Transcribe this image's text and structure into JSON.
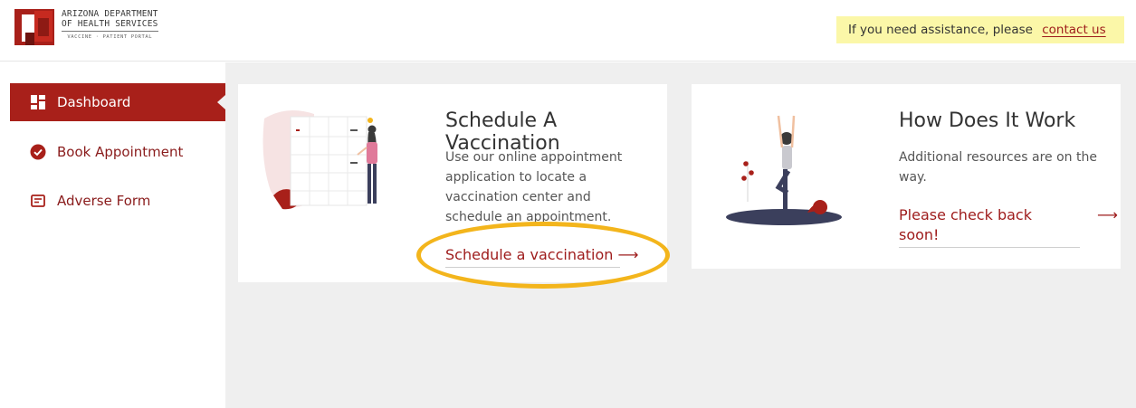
{
  "header": {
    "logo": {
      "line1": "ARIZONA DEPARTMENT",
      "line2": "OF HEALTH SERVICES",
      "subtitle": "VACCINE · PATIENT PORTAL"
    },
    "assistance": {
      "text": "If you need assistance, please",
      "link_label": "contact us"
    }
  },
  "sidebar": {
    "items": [
      {
        "label": "Dashboard",
        "icon": "dashboard-icon",
        "active": true
      },
      {
        "label": "Book Appointment",
        "icon": "check-circle-icon",
        "active": false
      },
      {
        "label": "Adverse Form",
        "icon": "form-icon",
        "active": false
      }
    ]
  },
  "cards": [
    {
      "title": "Schedule A Vaccination",
      "description": "Use our online appointment application to locate a vaccination center and schedule an appointment.",
      "link_label": "Schedule a vaccination",
      "arrow": "⟶"
    },
    {
      "title": "How Does It Work",
      "description": "Additional resources are on the way.",
      "link_label": "Please check back soon!",
      "arrow": "⟶"
    }
  ],
  "colors": {
    "brand_red": "#a8201a",
    "link_red": "#9e1b1b",
    "highlight_yellow": "#fbf7a8",
    "annotation_ring": "#f3b51c"
  }
}
